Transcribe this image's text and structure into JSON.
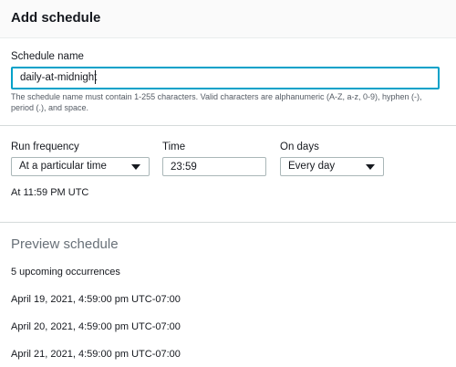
{
  "header": {
    "title": "Add schedule"
  },
  "schedule_name": {
    "label": "Schedule name",
    "value": "daily-at-midnight",
    "hint": "The schedule name must contain 1-255 characters. Valid characters are alphanumeric (A-Z, a-z, 0-9), hyphen (-), period (.), and space."
  },
  "run_frequency": {
    "label": "Run frequency",
    "selected": "At a particular time"
  },
  "time": {
    "label": "Time",
    "value": "23:59"
  },
  "on_days": {
    "label": "On days",
    "selected": "Every day"
  },
  "utc_summary": "At 11:59 PM UTC",
  "preview": {
    "title": "Preview schedule",
    "count_text": "5 upcoming occurrences",
    "occurrences": [
      "April 19, 2021, 4:59:00 pm UTC-07:00",
      "April 20, 2021, 4:59:00 pm UTC-07:00",
      "April 21, 2021, 4:59:00 pm UTC-07:00"
    ]
  },
  "colors": {
    "focus_border": "#00a1c9",
    "muted_heading": "#687078"
  }
}
